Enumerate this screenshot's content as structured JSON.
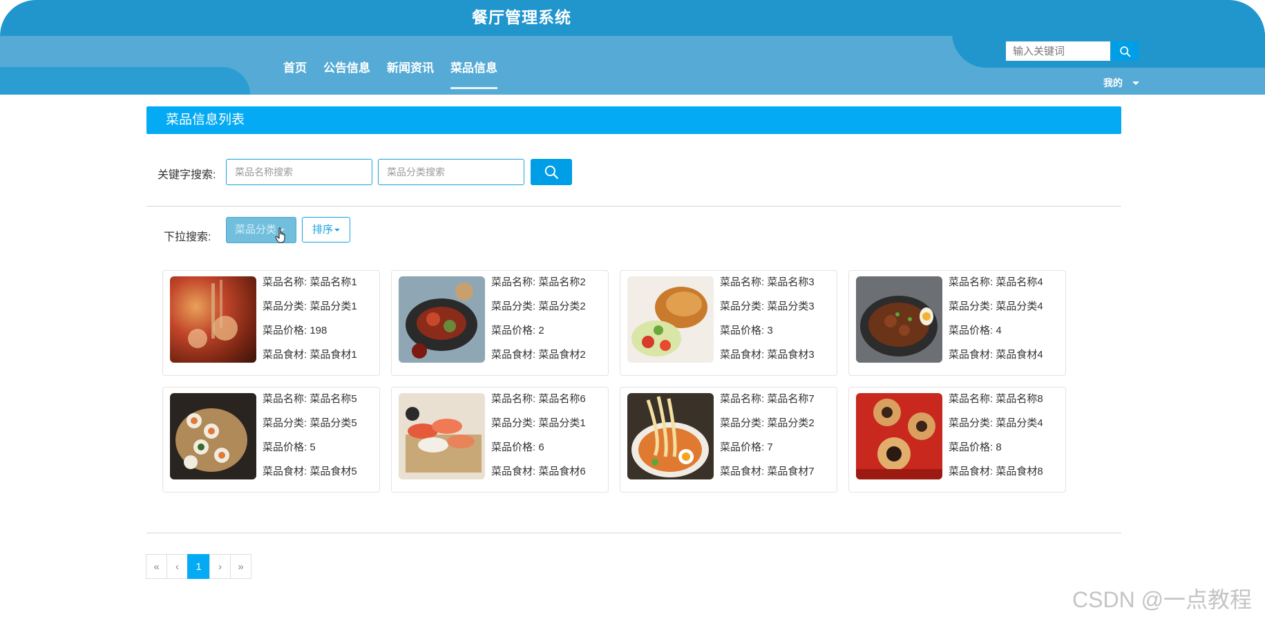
{
  "header": {
    "title": "餐厅管理系统",
    "nav": [
      "首页",
      "公告信息",
      "新闻资讯",
      "菜品信息"
    ],
    "search_placeholder": "输入关键词",
    "my_menu": "我的"
  },
  "panel": {
    "title": "菜品信息列表"
  },
  "filters": {
    "keyword_label": "关键字搜索:",
    "name_placeholder": "菜品名称搜索",
    "category_placeholder": "菜品分类搜索",
    "dropdown_label": "下拉搜索:",
    "category_button": "菜品分类",
    "sort_button": "排序"
  },
  "dishes": [
    {
      "name_label": "菜品名称: 菜品名称1",
      "category_label": "菜品分类: 菜品分类1",
      "price_label": "菜品价格: 198",
      "ingredient_label": "菜品食材: 菜品食材1"
    },
    {
      "name_label": "菜品名称: 菜品名称2",
      "category_label": "菜品分类: 菜品分类2",
      "price_label": "菜品价格: 2",
      "ingredient_label": "菜品食材: 菜品食材2"
    },
    {
      "name_label": "菜品名称: 菜品名称3",
      "category_label": "菜品分类: 菜品分类3",
      "price_label": "菜品价格: 3",
      "ingredient_label": "菜品食材: 菜品食材3"
    },
    {
      "name_label": "菜品名称: 菜品名称4",
      "category_label": "菜品分类: 菜品分类4",
      "price_label": "菜品价格: 4",
      "ingredient_label": "菜品食材: 菜品食材4"
    },
    {
      "name_label": "菜品名称: 菜品名称5",
      "category_label": "菜品分类: 菜品分类5",
      "price_label": "菜品价格: 5",
      "ingredient_label": "菜品食材: 菜品食材5"
    },
    {
      "name_label": "菜品名称: 菜品名称6",
      "category_label": "菜品分类: 菜品分类1",
      "price_label": "菜品价格: 6",
      "ingredient_label": "菜品食材: 菜品食材6"
    },
    {
      "name_label": "菜品名称: 菜品名称7",
      "category_label": "菜品分类: 菜品分类2",
      "price_label": "菜品价格: 7",
      "ingredient_label": "菜品食材: 菜品食材7"
    },
    {
      "name_label": "菜品名称: 菜品名称8",
      "category_label": "菜品分类: 菜品分类4",
      "price_label": "菜品价格: 8",
      "ingredient_label": "菜品食材: 菜品食材8"
    }
  ],
  "pagination": {
    "first": "«",
    "prev": "‹",
    "current": "1",
    "next": "›",
    "last": "»"
  },
  "watermark": "CSDN @一点教程",
  "colors": {
    "header_dark": "#2196cd",
    "header_light": "#55aad6",
    "accent": "#04aaf3"
  },
  "icons": {
    "search": "search-icon",
    "cursor": "hand-cursor-icon",
    "dropdown": "caret-down-icon"
  }
}
